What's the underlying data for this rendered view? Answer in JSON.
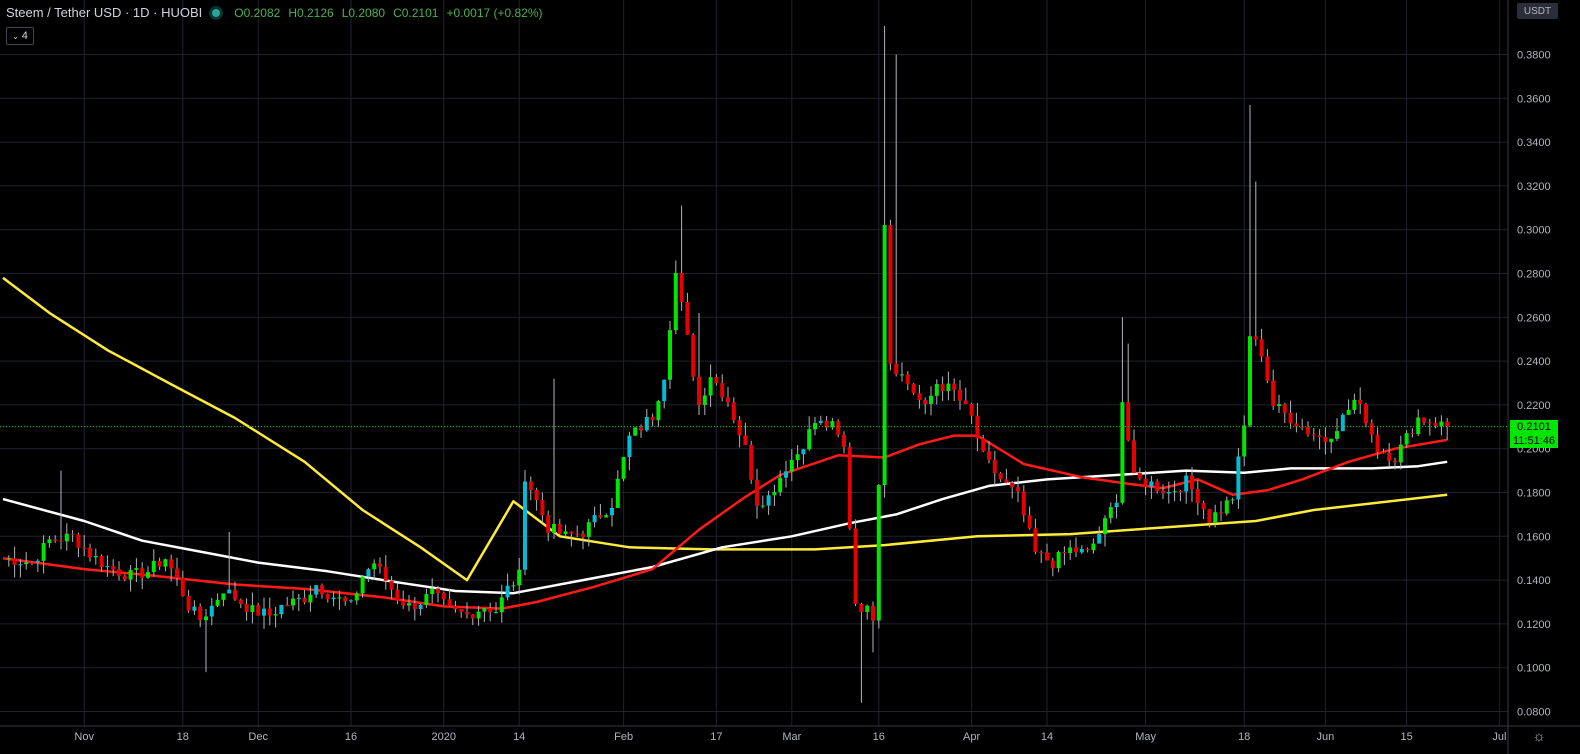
{
  "header": {
    "symbol": "Steem / Tether USD · 1D · HUOBI",
    "open_label": "O",
    "open": "0.2082",
    "high_label": "H",
    "high": "0.2126",
    "low_label": "L",
    "low": "0.2080",
    "close_label": "C",
    "close": "0.2101",
    "change": "+0.0017 (+0.82%)"
  },
  "indicators_toggle": {
    "label": "4"
  },
  "price_scale": {
    "currency": "USDT"
  },
  "last_price": {
    "value": "0.2101",
    "countdown": "11:51:46"
  },
  "colors": {
    "up": "#00e600",
    "down": "#e60000",
    "up_body_alt": "#00bcd4",
    "wick": "#b2b5be",
    "ma_yellow": "#ffeb3b",
    "ma_white": "#ffffff",
    "ma_red": "#ff1a1a",
    "last_price_line": "#00e600",
    "grid": "#1e222d"
  },
  "chart_data": {
    "type": "candlestick",
    "y_ticks": [
      0.08,
      0.1,
      0.12,
      0.14,
      0.16,
      0.18,
      0.2,
      0.22,
      0.24,
      0.26,
      0.28,
      0.3,
      0.32,
      0.34,
      0.36,
      0.38
    ],
    "ylim": [
      0.078,
      0.3937
    ],
    "x_tick_labels": [
      {
        "label": "Nov",
        "i": 14
      },
      {
        "label": "18",
        "i": 31
      },
      {
        "label": "Dec",
        "i": 44
      },
      {
        "label": "16",
        "i": 60
      },
      {
        "label": "2020",
        "i": 76
      },
      {
        "label": "14",
        "i": 89
      },
      {
        "label": "Feb",
        "i": 107
      },
      {
        "label": "17",
        "i": 123
      },
      {
        "label": "Mar",
        "i": 136
      },
      {
        "label": "16",
        "i": 151
      },
      {
        "label": "Apr",
        "i": 167
      },
      {
        "label": "14",
        "i": 180
      },
      {
        "label": "May",
        "i": 197
      },
      {
        "label": "18",
        "i": 214
      },
      {
        "label": "Jun",
        "i": 228
      },
      {
        "label": "15",
        "i": 242
      },
      {
        "label": "Jul",
        "i": 258
      }
    ],
    "last_index": 249,
    "anchors": [
      [
        0,
        0.15
      ],
      [
        5,
        0.148
      ],
      [
        8,
        0.158
      ],
      [
        12,
        0.16
      ],
      [
        15,
        0.152
      ],
      [
        18,
        0.146
      ],
      [
        22,
        0.142
      ],
      [
        25,
        0.144
      ],
      [
        28,
        0.15
      ],
      [
        30,
        0.14
      ],
      [
        32,
        0.128
      ],
      [
        34,
        0.122
      ],
      [
        36,
        0.128
      ],
      [
        38,
        0.136
      ],
      [
        40,
        0.132
      ],
      [
        43,
        0.126
      ],
      [
        46,
        0.124
      ],
      [
        48,
        0.128
      ],
      [
        52,
        0.132
      ],
      [
        54,
        0.138
      ],
      [
        56,
        0.134
      ],
      [
        60,
        0.128
      ],
      [
        62,
        0.142
      ],
      [
        64,
        0.148
      ],
      [
        66,
        0.14
      ],
      [
        68,
        0.132
      ],
      [
        70,
        0.128
      ],
      [
        72,
        0.13
      ],
      [
        74,
        0.134
      ],
      [
        77,
        0.126
      ],
      [
        80,
        0.124
      ],
      [
        83,
        0.128
      ],
      [
        85,
        0.126
      ],
      [
        87,
        0.136
      ],
      [
        89,
        0.142
      ],
      [
        90,
        0.188
      ],
      [
        92,
        0.176
      ],
      [
        94,
        0.164
      ],
      [
        97,
        0.16
      ],
      [
        100,
        0.162
      ],
      [
        103,
        0.17
      ],
      [
        105,
        0.175
      ],
      [
        108,
        0.205
      ],
      [
        112,
        0.215
      ],
      [
        114,
        0.234
      ],
      [
        116,
        0.28
      ],
      [
        118,
        0.25
      ],
      [
        120,
        0.22
      ],
      [
        122,
        0.234
      ],
      [
        125,
        0.222
      ],
      [
        128,
        0.2
      ],
      [
        130,
        0.176
      ],
      [
        132,
        0.178
      ],
      [
        135,
        0.192
      ],
      [
        137,
        0.198
      ],
      [
        140,
        0.212
      ],
      [
        143,
        0.21
      ],
      [
        145,
        0.2
      ],
      [
        147,
        0.13
      ],
      [
        150,
        0.124
      ],
      [
        151,
        0.186
      ],
      [
        152,
        0.304
      ],
      [
        153,
        0.24
      ],
      [
        156,
        0.23
      ],
      [
        159,
        0.218
      ],
      [
        161,
        0.23
      ],
      [
        164,
        0.226
      ],
      [
        167,
        0.214
      ],
      [
        169,
        0.196
      ],
      [
        172,
        0.186
      ],
      [
        175,
        0.178
      ],
      [
        178,
        0.152
      ],
      [
        181,
        0.148
      ],
      [
        184,
        0.154
      ],
      [
        187,
        0.152
      ],
      [
        190,
        0.166
      ],
      [
        192,
        0.178
      ],
      [
        193,
        0.222
      ],
      [
        195,
        0.186
      ],
      [
        198,
        0.184
      ],
      [
        201,
        0.18
      ],
      [
        204,
        0.185
      ],
      [
        206,
        0.178
      ],
      [
        208,
        0.168
      ],
      [
        210,
        0.172
      ],
      [
        212,
        0.178
      ],
      [
        214,
        0.21
      ],
      [
        215,
        0.252
      ],
      [
        217,
        0.244
      ],
      [
        219,
        0.22
      ],
      [
        222,
        0.214
      ],
      [
        225,
        0.208
      ],
      [
        228,
        0.204
      ],
      [
        231,
        0.214
      ],
      [
        233,
        0.222
      ],
      [
        235,
        0.214
      ],
      [
        237,
        0.2
      ],
      [
        240,
        0.196
      ],
      [
        242,
        0.205
      ],
      [
        244,
        0.214
      ],
      [
        247,
        0.212
      ],
      [
        249,
        0.21
      ]
    ],
    "spikes": [
      {
        "i": 10,
        "high": 0.19
      },
      {
        "i": 35,
        "low": 0.098
      },
      {
        "i": 39,
        "high": 0.162
      },
      {
        "i": 95,
        "high": 0.232
      },
      {
        "i": 117,
        "high": 0.311
      },
      {
        "i": 120,
        "high": 0.262
      },
      {
        "i": 148,
        "low": 0.084
      },
      {
        "i": 152,
        "high": 0.393
      },
      {
        "i": 154,
        "high": 0.38
      },
      {
        "i": 150,
        "low": 0.107
      },
      {
        "i": 193,
        "high": 0.26
      },
      {
        "i": 215,
        "high": 0.357
      },
      {
        "i": 216,
        "high": 0.322
      },
      {
        "i": 194,
        "high": 0.248
      }
    ],
    "series": [
      {
        "color": "#ffeb3b",
        "points": [
          [
            0,
            0.278
          ],
          [
            8,
            0.262
          ],
          [
            18,
            0.245
          ],
          [
            30,
            0.228
          ],
          [
            40,
            0.214
          ],
          [
            52,
            0.194
          ],
          [
            62,
            0.172
          ],
          [
            72,
            0.155
          ],
          [
            80,
            0.14
          ],
          [
            88,
            0.176
          ],
          [
            96,
            0.16
          ],
          [
            108,
            0.155
          ],
          [
            122,
            0.154
          ],
          [
            140,
            0.154
          ],
          [
            152,
            0.156
          ],
          [
            168,
            0.16
          ],
          [
            184,
            0.161
          ],
          [
            200,
            0.164
          ],
          [
            216,
            0.167
          ],
          [
            226,
            0.172
          ],
          [
            236,
            0.175
          ],
          [
            249,
            0.179
          ]
        ]
      },
      {
        "color": "#ffffff",
        "points": [
          [
            0,
            0.177
          ],
          [
            14,
            0.167
          ],
          [
            24,
            0.158
          ],
          [
            34,
            0.153
          ],
          [
            44,
            0.148
          ],
          [
            56,
            0.144
          ],
          [
            68,
            0.139
          ],
          [
            78,
            0.135
          ],
          [
            88,
            0.134
          ],
          [
            100,
            0.14
          ],
          [
            112,
            0.146
          ],
          [
            124,
            0.155
          ],
          [
            136,
            0.16
          ],
          [
            146,
            0.166
          ],
          [
            154,
            0.17
          ],
          [
            162,
            0.177
          ],
          [
            170,
            0.183
          ],
          [
            180,
            0.186
          ],
          [
            192,
            0.188
          ],
          [
            204,
            0.19
          ],
          [
            214,
            0.189
          ],
          [
            222,
            0.191
          ],
          [
            236,
            0.191
          ],
          [
            244,
            0.192
          ],
          [
            249,
            0.194
          ]
        ]
      },
      {
        "color": "#ff1a1a",
        "points": [
          [
            0,
            0.15
          ],
          [
            14,
            0.145
          ],
          [
            26,
            0.142
          ],
          [
            40,
            0.138
          ],
          [
            52,
            0.136
          ],
          [
            66,
            0.132
          ],
          [
            76,
            0.128
          ],
          [
            86,
            0.127
          ],
          [
            92,
            0.13
          ],
          [
            102,
            0.137
          ],
          [
            112,
            0.145
          ],
          [
            120,
            0.163
          ],
          [
            128,
            0.178
          ],
          [
            134,
            0.188
          ],
          [
            144,
            0.197
          ],
          [
            152,
            0.196
          ],
          [
            158,
            0.202
          ],
          [
            164,
            0.206
          ],
          [
            168,
            0.206
          ],
          [
            176,
            0.193
          ],
          [
            186,
            0.187
          ],
          [
            194,
            0.184
          ],
          [
            200,
            0.182
          ],
          [
            206,
            0.186
          ],
          [
            212,
            0.179
          ],
          [
            218,
            0.181
          ],
          [
            224,
            0.186
          ],
          [
            232,
            0.194
          ],
          [
            240,
            0.2
          ],
          [
            249,
            0.204
          ]
        ]
      }
    ]
  }
}
